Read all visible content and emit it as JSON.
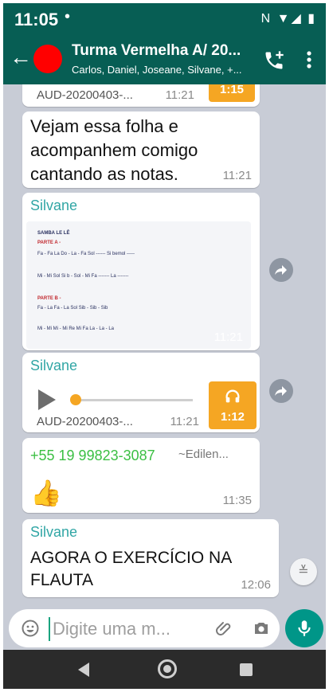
{
  "status_bar": {
    "time": "11:05",
    "dot": "•",
    "icons": "N ▼◢ ▮"
  },
  "header": {
    "back_icon": "arrow-left-icon",
    "title": "Turma Vermelha A/ 20...",
    "subtitle": "Carlos, Daniel, Joseane, Silvane, +...",
    "avatar_color": "#ff0000"
  },
  "messages": [
    {
      "type": "audio-partial",
      "filename": "AUD-20200403-...",
      "time": "11:21",
      "duration": "1:15"
    },
    {
      "type": "text",
      "lines": [
        "Vejam essa folha e",
        "acompanhem comigo",
        "cantando as notas."
      ],
      "time": "11:21"
    },
    {
      "type": "image",
      "sender": "Silvane",
      "time": "11:21",
      "image_lines": [
        "SAMBA LE LÊ",
        "PARTE A -",
        "Fa - Fa  La   Do - La - Fa          Sol ------  Si bemol -----",
        "Mi - Mi  Sol  Si b - Sol - Mi     Fa -------   La -------",
        "PARTE B -",
        "Fa - La  Fa - La  Sol  Sib - Sib - Sib",
        "Mi - Mi  Mi - Mi   Re   Mi   Fa   La - La - La"
      ]
    },
    {
      "type": "audio",
      "sender": "Silvane",
      "filename": "AUD-20200403-...",
      "time": "11:21",
      "duration": "1:12",
      "progress": 0.0
    },
    {
      "type": "sticker",
      "sender_phone": "+55 19 99823-3087",
      "sender_alias": "~Edilen...",
      "emoji": "👍",
      "time": "11:35"
    },
    {
      "type": "text",
      "sender": "Silvane",
      "lines": [
        "AGORA O EXERCÍCIO NA",
        "FLAUTA"
      ],
      "time": "12:06"
    }
  ],
  "composer": {
    "placeholder": "Digite uma m..."
  },
  "colors": {
    "header": "#075e54",
    "accent_orange": "#f5a623",
    "sender_teal": "#31a6a5",
    "phone_green": "#3bbf43",
    "mic": "#009688"
  }
}
